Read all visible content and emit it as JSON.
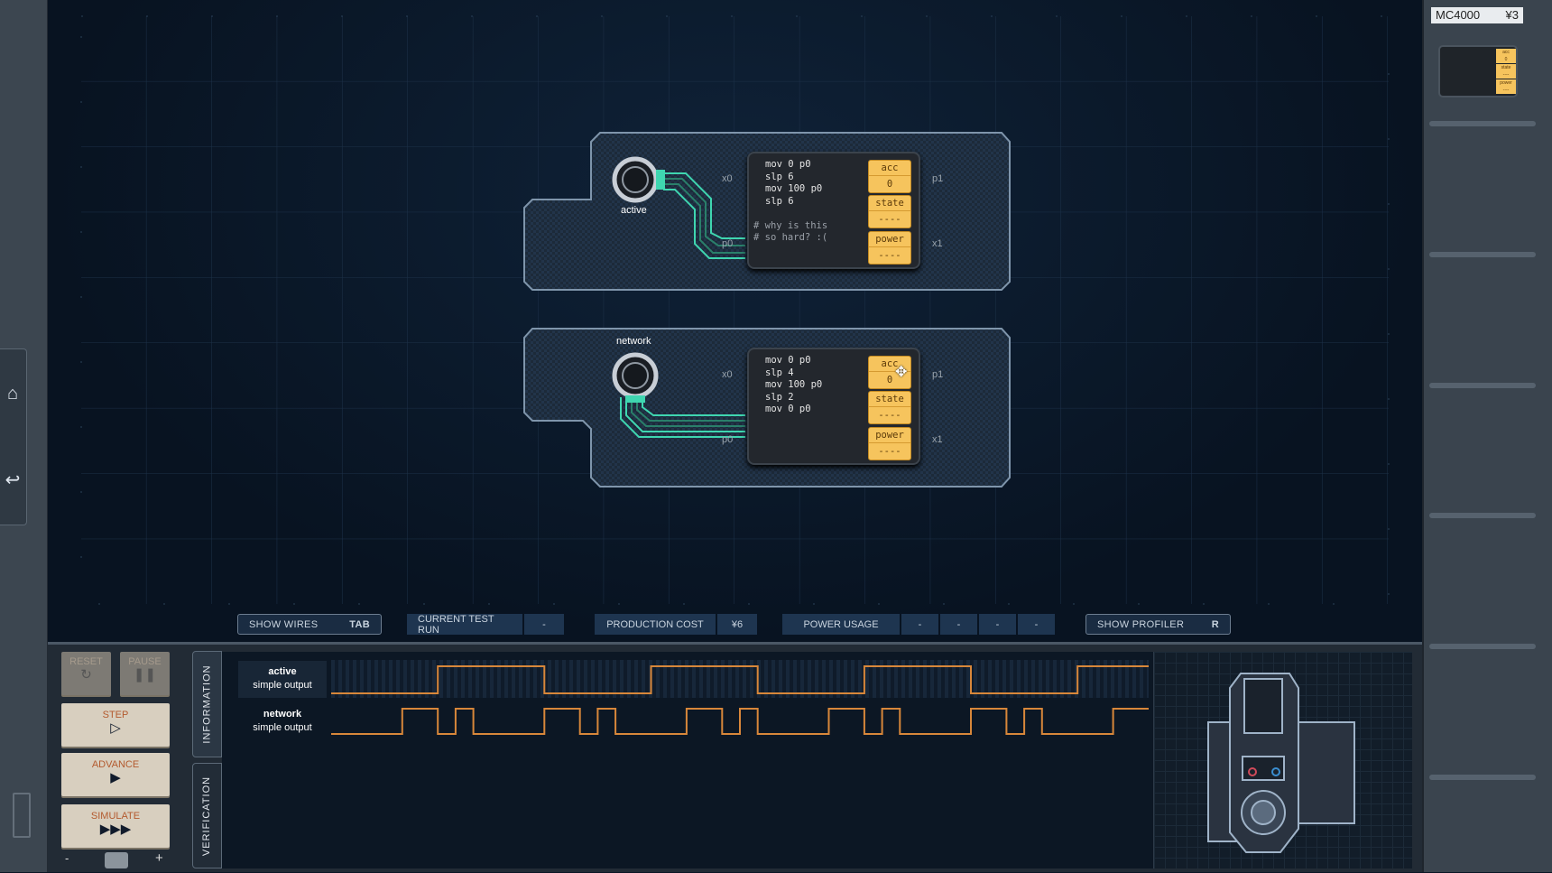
{
  "sidebar": {
    "icons": [
      "home-icon",
      "undo-icon"
    ]
  },
  "toolbar": {
    "show_wires": {
      "label": "SHOW WIRES",
      "key": "TAB"
    },
    "current_test_run": {
      "label": "CURRENT TEST RUN",
      "value": "-"
    },
    "production_cost": {
      "label": "PRODUCTION COST",
      "value": "¥6"
    },
    "power_usage": {
      "label": "POWER USAGE",
      "values": [
        "-",
        "-",
        "-",
        "-"
      ]
    },
    "show_profiler": {
      "label": "SHOW PROFILER",
      "key": "R"
    }
  },
  "parts_panel": {
    "part_name": "MC4000",
    "part_cost": "¥3",
    "mini_regs": [
      "acc",
      "0",
      "state",
      "----",
      "power",
      "----"
    ]
  },
  "boards": [
    {
      "sensor": "active",
      "code": [
        "mov 0 p0",
        "slp 6",
        "mov 100 p0",
        "slp 6",
        "",
        "# why is this",
        "# so hard? :("
      ],
      "regs": {
        "acc_label": "acc",
        "acc": "0",
        "state_label": "state",
        "state": "----",
        "power_label": "power",
        "power": "----"
      },
      "ports": {
        "x0": "x0",
        "p0": "p0",
        "p1": "p1",
        "x1": "x1"
      }
    },
    {
      "sensor": "network",
      "code": [
        "mov 0 p0",
        "slp 4",
        "mov 100 p0",
        "slp 2",
        "mov 0 p0"
      ],
      "regs": {
        "acc_label": "acc",
        "acc": "0",
        "state_label": "state",
        "state": "----",
        "power_label": "power",
        "power": "----"
      },
      "ports": {
        "x0": "x0",
        "p0": "p0",
        "p1": "p1",
        "x1": "x1"
      }
    }
  ],
  "controls": {
    "reset": "RESET",
    "pause": "PAUSE",
    "step": "STEP",
    "advance": "ADVANCE",
    "simulate": "SIMULATE",
    "zoom_minus": "-",
    "zoom_plus": "+"
  },
  "tabs": {
    "information": "INFORMATION",
    "verification": "VERIFICATION"
  },
  "signals": [
    {
      "name": "active",
      "type": "simple output",
      "values": [
        0,
        0,
        0,
        0,
        0,
        0,
        100,
        100,
        100,
        100,
        100,
        100,
        0,
        0,
        0,
        0,
        0,
        0,
        100,
        100,
        100,
        100,
        100,
        100,
        0,
        0,
        0,
        0,
        0,
        0,
        100,
        100,
        100,
        100,
        100,
        100,
        0,
        0,
        0,
        0,
        0,
        0,
        100,
        100,
        100,
        100
      ]
    },
    {
      "name": "network",
      "type": "simple output",
      "values": [
        0,
        0,
        0,
        0,
        100,
        100,
        0,
        100,
        0,
        0,
        0,
        0,
        100,
        100,
        0,
        100,
        0,
        0,
        0,
        0,
        100,
        100,
        0,
        100,
        0,
        0,
        0,
        0,
        100,
        100,
        0,
        100,
        0,
        0,
        0,
        0,
        100,
        100,
        0,
        100,
        0,
        0,
        0,
        0,
        100,
        100
      ]
    }
  ],
  "colors": {
    "wire": "#3fd6b0",
    "register": "#f6c45d",
    "signal": "#d8873a"
  }
}
